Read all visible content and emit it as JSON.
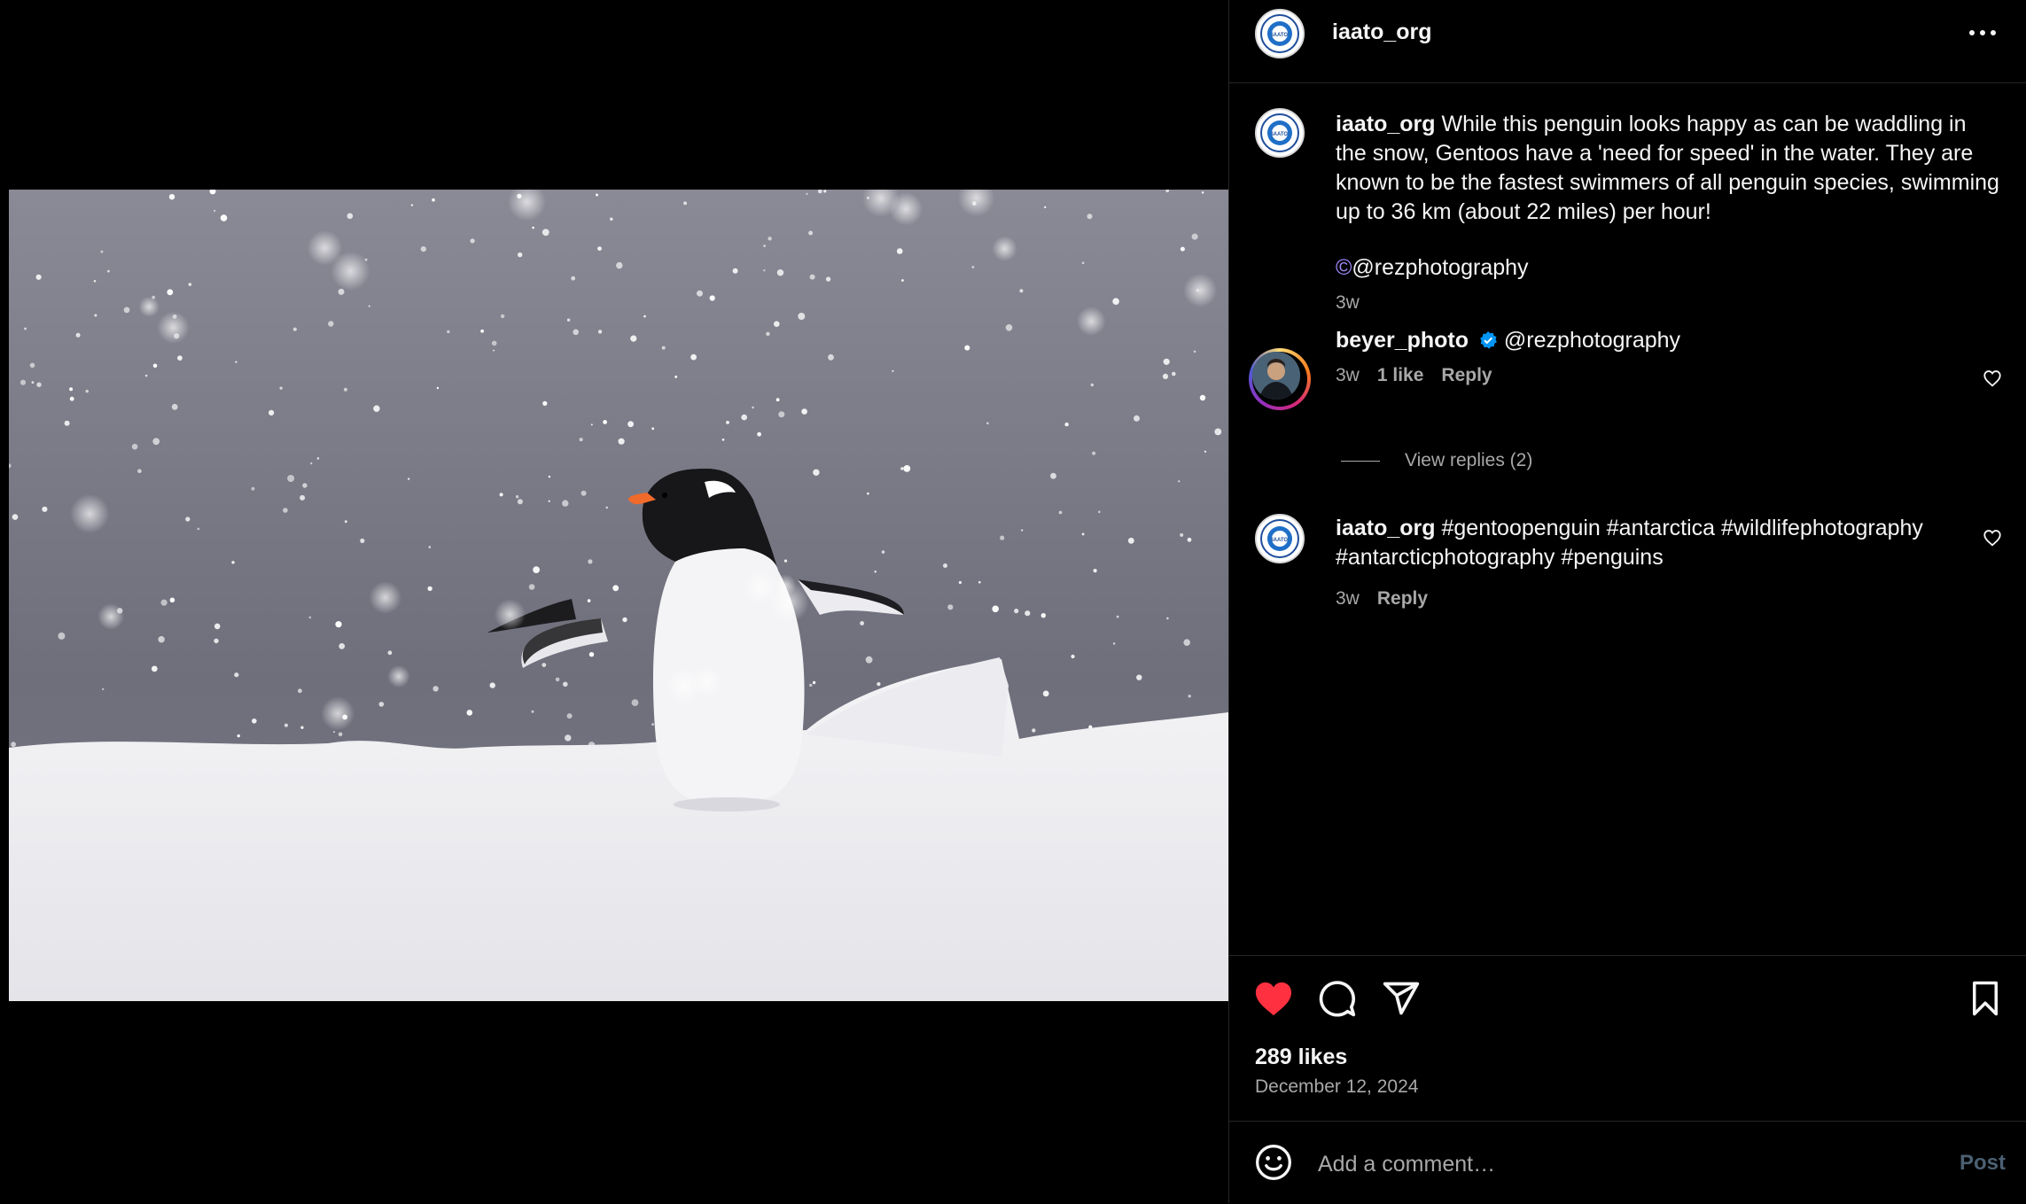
{
  "header": {
    "username": "iaato_org",
    "logo_text": "IAATO"
  },
  "caption": {
    "username": "iaato_org",
    "text": " While this penguin looks happy as can be waddling in the snow, Gentoos have a 'need for speed' in the water. They are known to be the fastest swimmers of all penguin species, swimming up to 36 km (about 22 miles) per hour!",
    "credit_symbol": "©",
    "credit": "@rezphotography",
    "time": "3w"
  },
  "comments": [
    {
      "username": "beyer_photo",
      "verified": true,
      "text": " @rezphotography",
      "time": "3w",
      "likes": "1 like",
      "reply": "Reply",
      "view_replies": "View replies (2)"
    },
    {
      "username": "iaato_org",
      "text": " #gentoopenguin #antarctica #wildlifephotography #antarcticphotography #penguins",
      "time": "3w",
      "reply": "Reply"
    }
  ],
  "actions": {
    "liked": true,
    "like_color": "#ff3040"
  },
  "likes": "289 likes",
  "date": "December 12, 2024",
  "comment_box": {
    "placeholder": "Add a comment…",
    "post_label": "Post"
  },
  "colors": {
    "background": "#000000",
    "secondary_text": "#a8a8a8",
    "verified": "#0095f6",
    "post_disabled": "#4b6072"
  }
}
